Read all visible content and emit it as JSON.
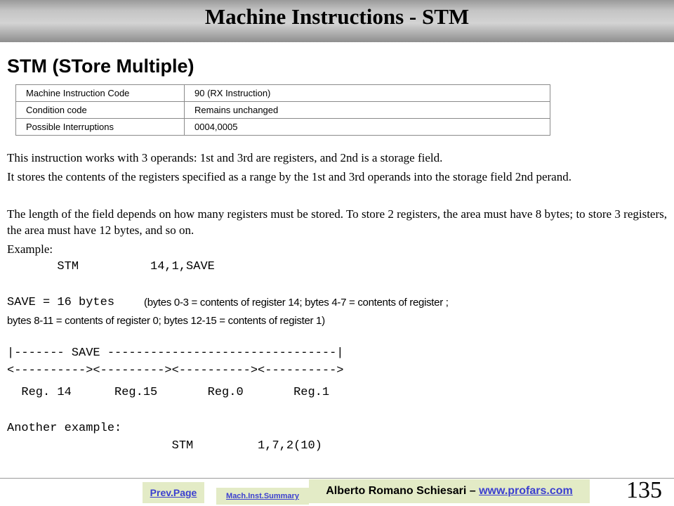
{
  "header": {
    "title": "Machine Instructions - STM"
  },
  "subtitle": "STM (STore Multiple)",
  "info_table": {
    "rows": [
      {
        "label": "Machine Instruction Code",
        "value": "90 (RX Instruction)"
      },
      {
        "label": "Condition code",
        "value": "Remains unchanged"
      },
      {
        "label": "Possible Interruptions",
        "value": "0004,0005"
      }
    ]
  },
  "body": {
    "p1": "This instruction works with 3 operands: 1st and 3rd are registers, and 2nd is a storage field.",
    "p2": "It stores the contents of the registers specified as a range by the 1st and 3rd operands into the storage field 2nd perand.",
    "p3": "The length of the field depends on how many registers must be stored. To store 2 registers, the area must have 8 bytes; to store 3 registers, the area must have 12 bytes, and so on.",
    "example_label": "Example:",
    "example_code": "       STM          14,1,SAVE",
    "save_code": "SAVE = 16 bytes",
    "save_note_1": " (bytes 0-3 = contents of  register 14; bytes 4-7 = contents of register ;",
    "save_note_2": "bytes 8-11 = contents of register  0;  bytes 12-15 = contents of register 1)",
    "diagram_line1": "|------- SAVE --------------------------------|",
    "diagram_line2": "<----------><---------><----------><---------->",
    "diagram_line3": "  Reg. 14      Reg.15       Reg.0       Reg.1",
    "another_label": "Another example:",
    "another_code": "                       STM         1,7,2(10)"
  },
  "footer": {
    "prev_label": "Prev.Page",
    "summary_label": "Mach.Inst.Summary",
    "author": "Alberto Romano Schiesari – ",
    "author_link": "www.profars.com",
    "page_number": "135"
  },
  "colors": {
    "link": "#3b3fd0",
    "footer_bg": "#e3ebc6",
    "title_bar": "#c4c4c4"
  }
}
